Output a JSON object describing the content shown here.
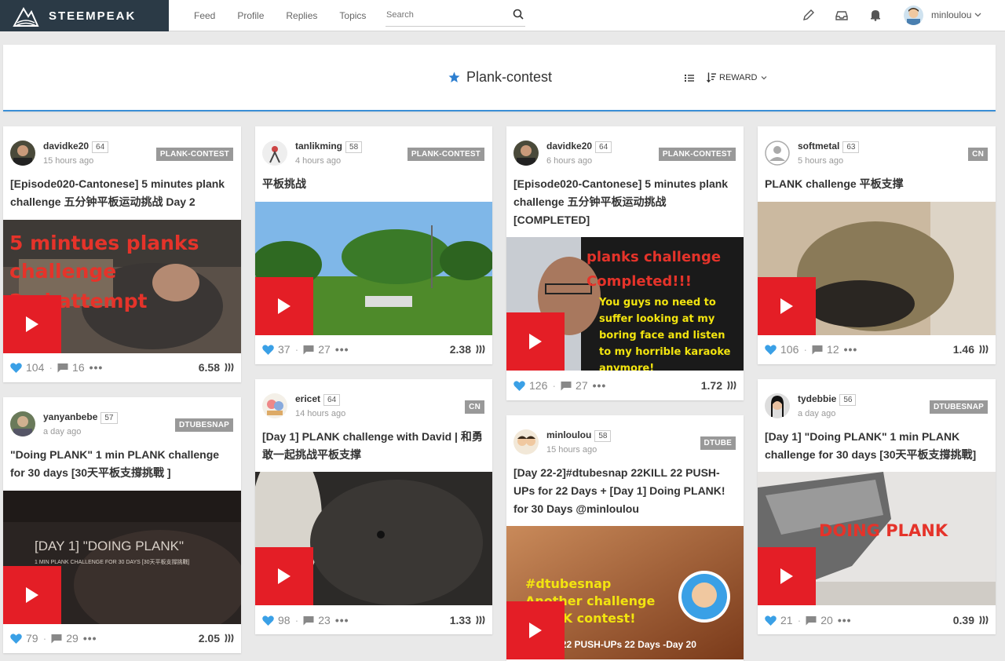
{
  "brand": {
    "name": "STEEMPEAK"
  },
  "nav": {
    "feed": "Feed",
    "profile": "Profile",
    "replies": "Replies",
    "topics": "Topics"
  },
  "search": {
    "placeholder": "Search"
  },
  "user": {
    "name": "minloulou"
  },
  "page": {
    "tag_title": "Plank-contest",
    "sort_label": "REWARD"
  },
  "cards": [
    {
      "user": "davidke20",
      "rep": "64",
      "time": "15 hours ago",
      "tag": "PLANK-CONTEST",
      "title": "[Episode020-Cantonese] 5 minutes plank challenge 五分钟平板运动挑战 Day 2",
      "thumb_text": [
        "5 mintues planks",
        "challenge",
        "2nd attempt"
      ],
      "votes": "104",
      "comments": "16",
      "payout": "6.58"
    },
    {
      "user": "yanyanbebe",
      "rep": "57",
      "time": "a day ago",
      "tag": "DTUBESNAP",
      "title": "\"Doing PLANK\" 1 min PLANK challenge for 30 days [30天平板支撐挑戰 ]",
      "thumb_text": [
        "[DAY 1] \"DOING PLANK\"",
        "1 MIN PLANK CHALLENGE FOR 30 DAYS [30天平板支撐挑戰]"
      ],
      "votes": "79",
      "comments": "29",
      "payout": "2.05"
    },
    {
      "user": "tanlikming",
      "rep": "58",
      "time": "4 hours ago",
      "tag": "PLANK-CONTEST",
      "title": "平板挑战",
      "votes": "37",
      "comments": "27",
      "payout": "2.38"
    },
    {
      "user": "ericet",
      "rep": "64",
      "time": "14 hours ago",
      "tag": "CN",
      "title": "[Day 1] PLANK challenge with David | 和勇敢一起挑战平板支撑",
      "votes": "98",
      "comments": "23",
      "payout": "1.33"
    },
    {
      "user": "davidke20",
      "rep": "64",
      "time": "6 hours ago",
      "tag": "PLANK-CONTEST",
      "title": "[Episode020-Cantonese] 5 minutes plank challenge 五分钟平板运动挑战 [COMPLETED]",
      "thumb_text": [
        "planks challenge",
        "Completed!!!",
        "You guys no need to",
        "suffer looking at my",
        "boring face and listen",
        "to my horrible karaoke",
        "anymore!"
      ],
      "votes": "126",
      "comments": "27",
      "payout": "1.72"
    },
    {
      "user": "minloulou",
      "rep": "58",
      "time": "15 hours ago",
      "tag": "DTUBE",
      "title": "[Day 22-2]#dtubesnap 22KILL 22 PUSH-UPs for 22 Days + [Day 1] Doing PLANK! for 30 Days @minloulou",
      "thumb_text": [
        "#dtubesnap",
        "Another challenge",
        "PLANK contest!",
        "#22KILL 22 PUSH-UPs 22 Days -Day 20"
      ]
    },
    {
      "user": "softmetal",
      "rep": "63",
      "time": "5 hours ago",
      "tag": "CN",
      "title": "PLANK challenge 平板支撑",
      "votes": "106",
      "comments": "12",
      "payout": "1.46"
    },
    {
      "user": "tydebbie",
      "rep": "56",
      "time": "a day ago",
      "tag": "DTUBESNAP",
      "title": "[Day 1] \"Doing PLANK\" 1 min PLANK challenge for 30 days [30天平板支撐挑戰]",
      "thumb_text": [
        "DOING PLANK"
      ],
      "votes": "21",
      "comments": "20",
      "payout": "0.39"
    }
  ],
  "colors": {
    "accent": "#3a8fd6",
    "play": "#e41e26",
    "tag_bg": "#999999",
    "logo_bg": "#2b3a46"
  }
}
